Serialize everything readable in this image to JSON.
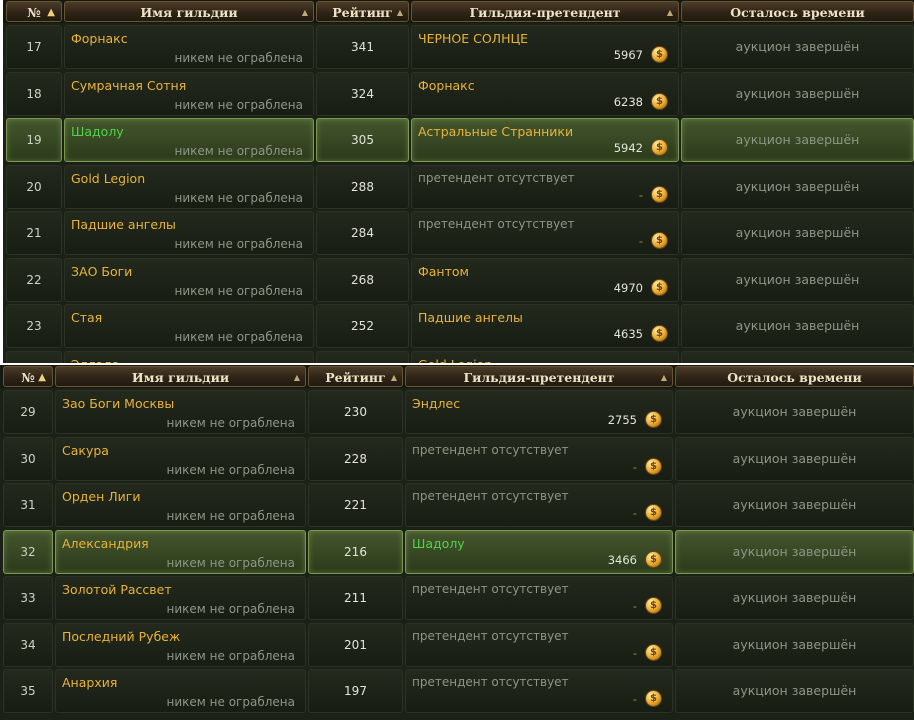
{
  "columns": {
    "num": "№",
    "name": "Имя гильдии",
    "rating": "Рейтинг",
    "claimant": "Гильдия-претендент",
    "time": "Осталось времени"
  },
  "icons": {
    "sort_active": "sort-up-arrow",
    "sort_inactive": "sort-up-down-arrows",
    "currency": "gold-coin-icon"
  },
  "colors": {
    "guild_name": "#e8b33c",
    "own_guild": "#4fd44a",
    "muted_text": "#8d9686",
    "highlight_row": "#44562d"
  },
  "top_table": {
    "rows": [
      {
        "num": "17",
        "name": "Форнакс",
        "note": "никем не ограблена",
        "rating": "341",
        "claimant": "ЧЕРНОЕ СОЛНЦЕ",
        "bid": "5967",
        "time": "аукцион завершён"
      },
      {
        "num": "18",
        "name": "Сумрачная Сотня",
        "note": "никем не ограблена",
        "rating": "324",
        "claimant": "Форнакс",
        "bid": "6238",
        "time": "аукцион завершён"
      },
      {
        "num": "19",
        "name": "Шадолу",
        "note": "никем не ограблена",
        "rating": "305",
        "claimant": "Астральные Странники",
        "bid": "5942",
        "time": "аукцион завершён",
        "highlight": true
      },
      {
        "num": "20",
        "name": "Gold Legion",
        "note": "никем не ограблена",
        "rating": "288",
        "claimant": "претендент отсутствует",
        "bid": "-",
        "time": "аукцион завершён",
        "no_claimant": true
      },
      {
        "num": "21",
        "name": "Падшие ангелы",
        "note": "никем не ограблена",
        "rating": "284",
        "claimant": "претендент отсутствует",
        "bid": "-",
        "time": "аукцион завершён",
        "no_claimant": true
      },
      {
        "num": "22",
        "name": "ЗАО Боги",
        "note": "никем не ограблена",
        "rating": "268",
        "claimant": "Фантом",
        "bid": "4970",
        "time": "аукцион завершён"
      },
      {
        "num": "23",
        "name": "Стая",
        "note": "никем не ограблена",
        "rating": "252",
        "claimant": "Падшие ангелы",
        "bid": "4635",
        "time": "аукцион завершён"
      }
    ],
    "partial_row": {
      "name": "Эллада",
      "claimant": "Gold Legion"
    }
  },
  "bottom_table": {
    "rows": [
      {
        "num": "29",
        "name": "Зао Боги Москвы",
        "note": "никем не ограблена",
        "rating": "230",
        "claimant": "Эндлес",
        "bid": "2755",
        "time": "аукцион завершён"
      },
      {
        "num": "30",
        "name": "Сакура",
        "note": "никем не ограблена",
        "rating": "228",
        "claimant": "претендент отсутствует",
        "bid": "-",
        "time": "аукцион завершён",
        "no_claimant": true
      },
      {
        "num": "31",
        "name": "Орден Лиги",
        "note": "никем не ограблена",
        "rating": "221",
        "claimant": "претендент отсутствует",
        "bid": "-",
        "time": "аукцион завершён",
        "no_claimant": true
      },
      {
        "num": "32",
        "name": "Александрия",
        "note": "никем не ограблена",
        "rating": "216",
        "claimant": "Шадолу",
        "bid": "3466",
        "time": "аукцион завершён",
        "highlight": true,
        "claimant_green": true
      },
      {
        "num": "33",
        "name": "Золотой Рассвет",
        "note": "никем не ограблена",
        "rating": "211",
        "claimant": "претендент отсутствует",
        "bid": "-",
        "time": "аукцион завершён",
        "no_claimant": true
      },
      {
        "num": "34",
        "name": "Последний Рубеж",
        "note": "никем не ограблена",
        "rating": "201",
        "claimant": "претендент отсутствует",
        "bid": "-",
        "time": "аукцион завершён",
        "no_claimant": true
      },
      {
        "num": "35",
        "name": "Анархия",
        "note": "никем не ограблена",
        "rating": "197",
        "claimant": "претендент отсутствует",
        "bid": "-",
        "time": "аукцион завершён",
        "no_claimant": true
      }
    ]
  }
}
